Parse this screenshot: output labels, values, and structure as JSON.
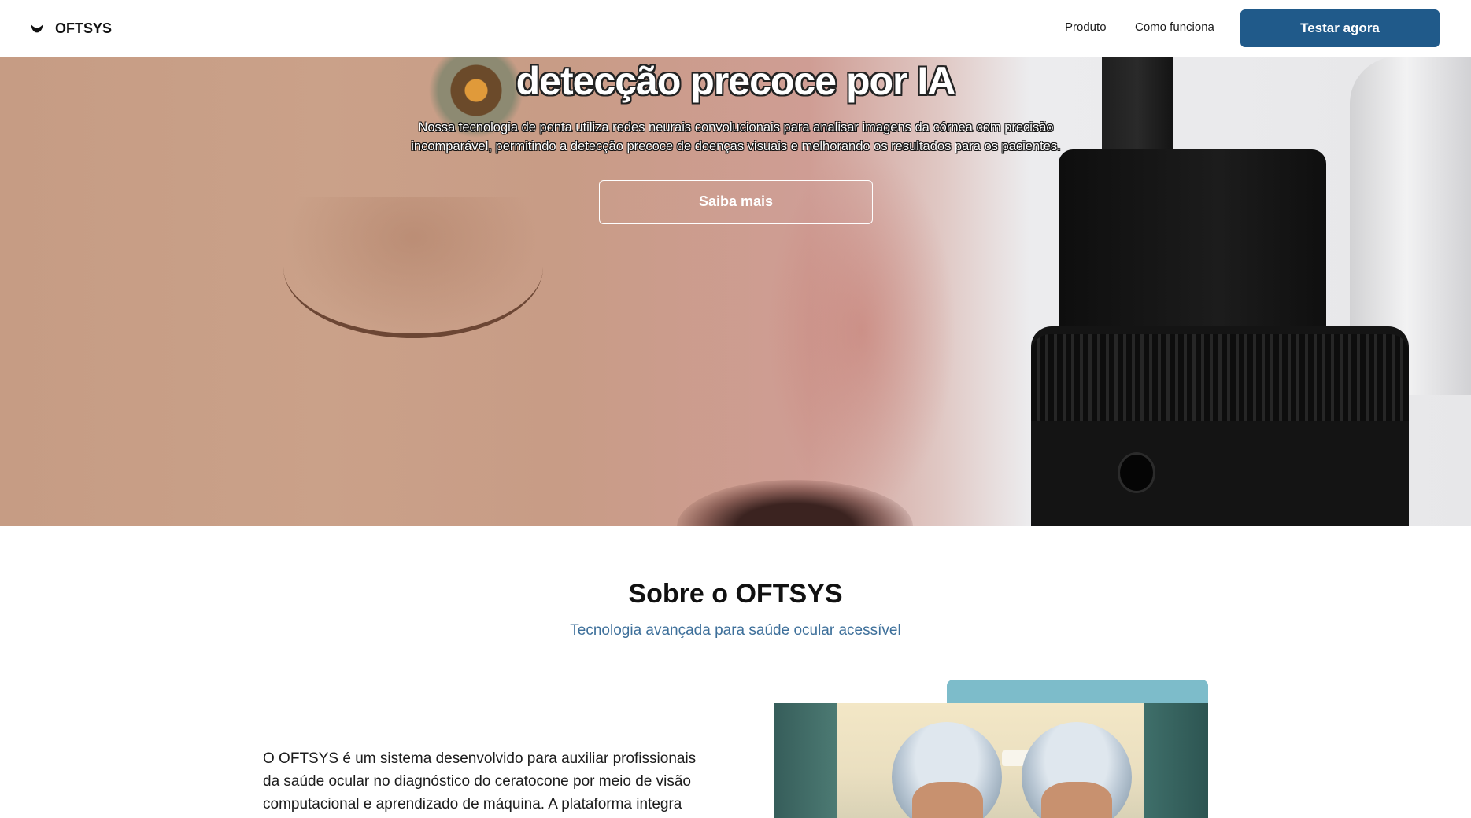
{
  "navbar": {
    "brand_icon": "brand-logo-icon",
    "brand": "OFTSYS",
    "links": [
      "Produto",
      "Como funciona"
    ],
    "cta": "Testar agora",
    "cta_color": "#205a8a"
  },
  "hero": {
    "title": "detecção precoce por IA",
    "description": "Nossa tecnologia de ponta utiliza redes neurais convolucionais para analisar imagens da córnea com precisão incomparável, permitindo a detecção precoce de doenças visuais e melhorando os resultados para os pacientes.",
    "cta": "Saiba mais"
  },
  "about": {
    "title": "Sobre o OFTSYS",
    "subtitle": "Tecnologia avançada para saúde ocular acessível",
    "subtitle_color": "#3d6f9a",
    "body": "O OFTSYS é um sistema desenvolvido para auxiliar profissionais da saúde ocular no diagnóstico do ceratocone por meio de visão computacional e aprendizado de máquina. A plataforma integra",
    "accent_color": "#7dbcca"
  }
}
